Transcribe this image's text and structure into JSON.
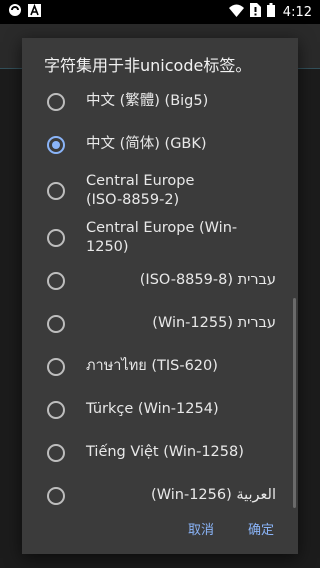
{
  "status_bar": {
    "time": "4:12",
    "icons": [
      "app-notification-icon",
      "letter-a-icon",
      "wifi-icon",
      "no-sim-icon",
      "battery-icon"
    ]
  },
  "dialog": {
    "title": "字符集用于非unicode标签。",
    "options": [
      {
        "label": "中文 (繁體) (Big5)",
        "checked": false
      },
      {
        "label": "中文 (简体) (GBK)",
        "checked": true
      },
      {
        "label": "Central Europe\n(ISO-8859-2)",
        "checked": false
      },
      {
        "label": "Central Europe (Win-1250)",
        "checked": false
      },
      {
        "label": "עברית (ISO-8859-8)",
        "checked": false
      },
      {
        "label": "עברית (Win-1255)",
        "checked": false
      },
      {
        "label": "ภาษาไทย (TIS-620)",
        "checked": false
      },
      {
        "label": "Türkçe (Win-1254)",
        "checked": false
      },
      {
        "label": "Tiếng Việt (Win-1258)",
        "checked": false
      },
      {
        "label": "العربية (Win-1256)",
        "checked": false
      }
    ],
    "cancel_label": "取消",
    "ok_label": "确定"
  },
  "colors": {
    "accent": "#8ab4f8",
    "dialog_bg": "#3b3b3b"
  }
}
